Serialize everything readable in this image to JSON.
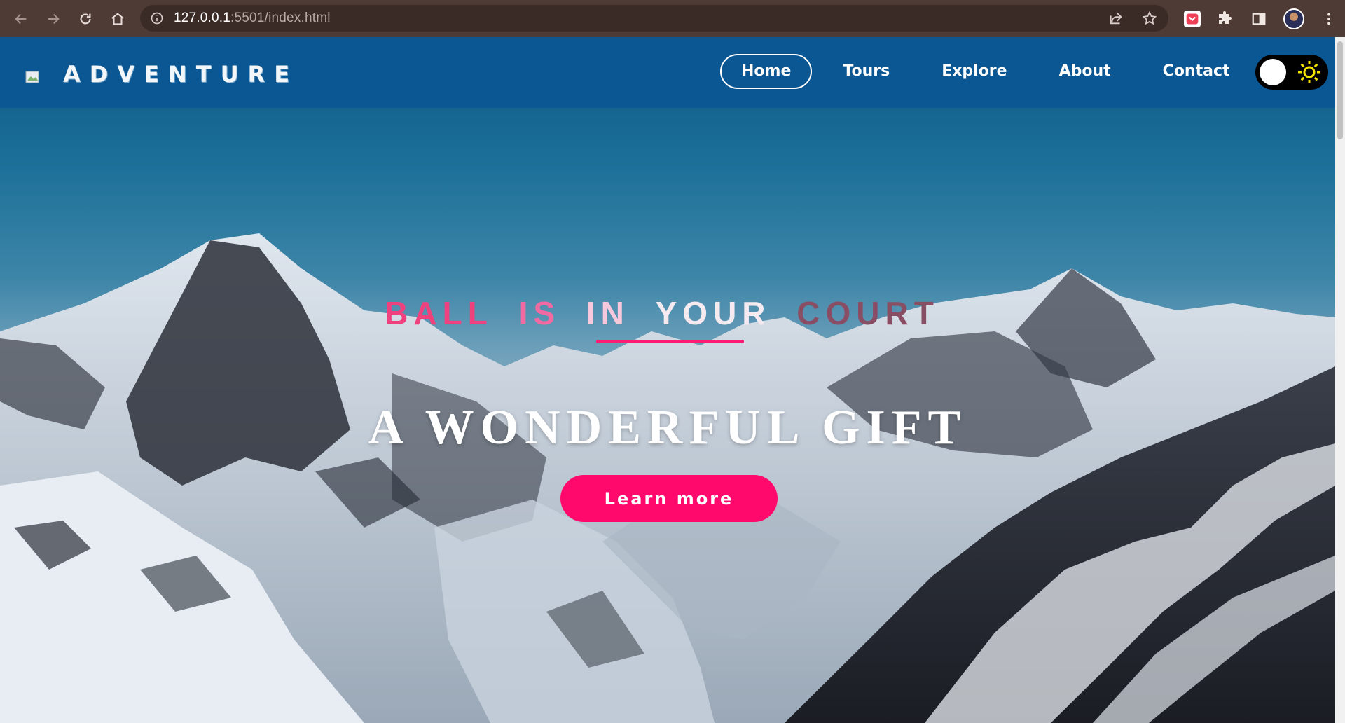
{
  "browser": {
    "url_host": "127.0.0.1",
    "url_rest": ":5501/index.html"
  },
  "site": {
    "brand": "ADVENTURE",
    "nav": [
      {
        "label": "Home",
        "active": true
      },
      {
        "label": "Tours",
        "active": false
      },
      {
        "label": "Explore",
        "active": false
      },
      {
        "label": "About",
        "active": false
      },
      {
        "label": "Contact",
        "active": false
      }
    ]
  },
  "hero": {
    "tagline_words": [
      {
        "text": "BALL",
        "color": "#f0417f"
      },
      {
        "text": "IS",
        "color": "#f36aa3"
      },
      {
        "text": "IN",
        "color": "#f7c7dc"
      },
      {
        "text": "YOUR",
        "color": "#f4eaf0"
      },
      {
        "text": "COURT",
        "color": "#8a4e64"
      }
    ],
    "headline": "A WONDERFUL GIFT",
    "cta_label": "Learn more"
  },
  "colors": {
    "header_bg": "#0b5793",
    "accent_pink": "#ff0a6c",
    "toggle_sun": "#f5e400"
  }
}
